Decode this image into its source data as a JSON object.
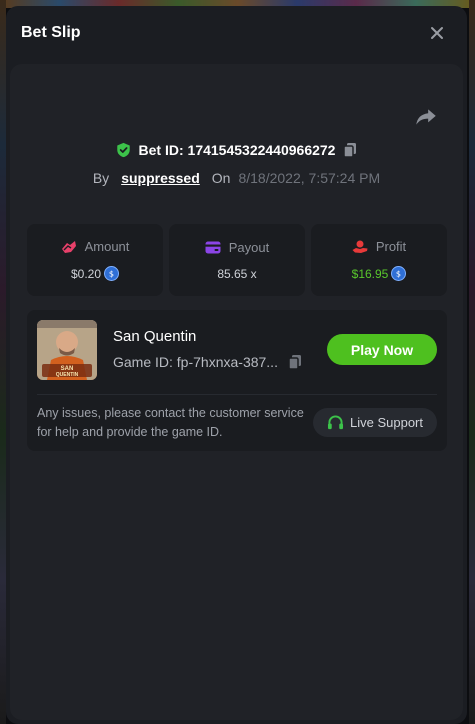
{
  "modal": {
    "title": "Bet Slip",
    "close_icon": "close-icon"
  },
  "bet": {
    "id_label": "Bet ID: 1741545322440966272",
    "by_label": "By",
    "user": "suppressed",
    "on_label": "On",
    "date": "8/18/2022, 7:57:24 PM"
  },
  "stats": {
    "amount": {
      "label": "Amount",
      "value": "$0.20",
      "icon": "wager-icon",
      "color": "#e8406a"
    },
    "payout": {
      "label": "Payout",
      "value": "85.65 x",
      "icon": "wallet-icon",
      "color": "#8b45e6"
    },
    "profit": {
      "label": "Profit",
      "value": "$16.95",
      "icon": "profit-hand-icon",
      "color": "#e83a3a",
      "value_color": "#59c82c"
    }
  },
  "game": {
    "name": "San Quentin",
    "id_label": "Game ID: fp-7hxnxa-387...",
    "thumb_text_1": "SAN",
    "thumb_text_2": "QUENTIN",
    "play_label": "Play Now"
  },
  "support": {
    "text": "Any issues, please contact the customer service for help and provide the game ID.",
    "button_label": "Live Support"
  },
  "colors": {
    "accent_green": "#4ec01f",
    "verified_green": "#3cc24a",
    "coin_blue": "#2f6fd6"
  }
}
